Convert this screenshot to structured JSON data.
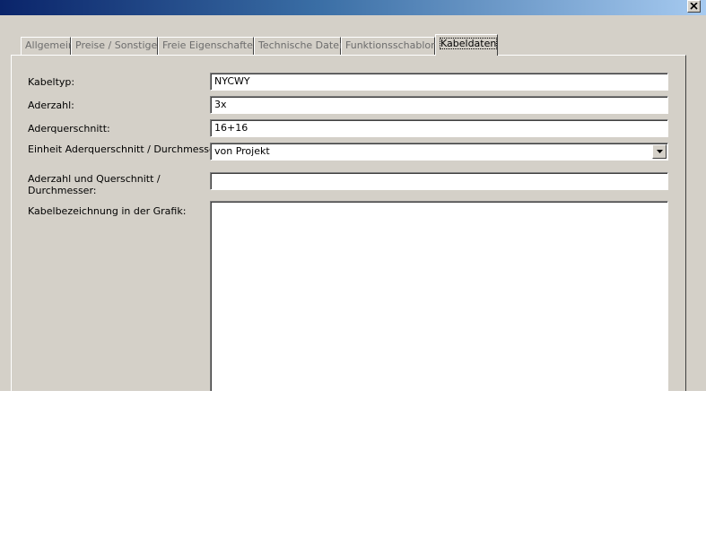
{
  "window": {
    "close_icon": "close-x-icon"
  },
  "tabs": [
    {
      "label": "Allgemein",
      "active": false
    },
    {
      "label": "Preise / Sonstiges",
      "active": false
    },
    {
      "label": "Freie Eigenschaften",
      "active": false
    },
    {
      "label": "Technische Daten",
      "active": false
    },
    {
      "label": "Funktionsschablone",
      "active": false
    },
    {
      "label": "Kabeldaten",
      "active": true
    }
  ],
  "form": {
    "kabeltyp": {
      "label": "Kabeltyp:",
      "value": "NYCWY"
    },
    "aderzahl": {
      "label": "Aderzahl:",
      "value": "3x"
    },
    "aderquerschnitt": {
      "label": "Aderquerschnitt:",
      "value": "16+16"
    },
    "einheit": {
      "label": "Einheit Aderquerschnitt / Durchmesser:",
      "value": "von Projekt"
    },
    "aderzahl_querschnitt": {
      "label_line1": "Aderzahl und Querschnitt /",
      "label_line2": "Durchmesser:",
      "value": ""
    },
    "kabelbezeichnung": {
      "label": "Kabelbezeichnung in der Grafik:",
      "value": ""
    }
  }
}
